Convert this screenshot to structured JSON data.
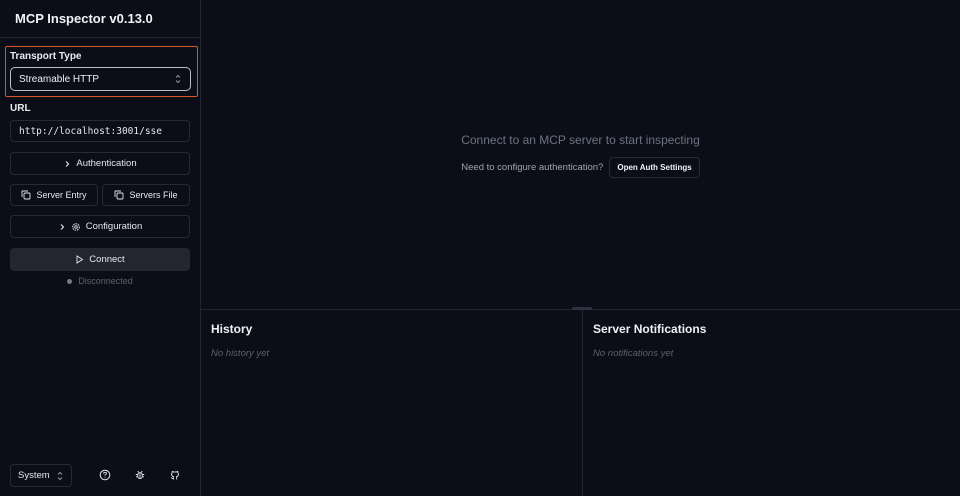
{
  "app": {
    "title": "MCP Inspector v0.13.0"
  },
  "sidebar": {
    "transport_label": "Transport Type",
    "transport_value": "Streamable HTTP",
    "url_label": "URL",
    "url_value": "http://localhost:3001/sse",
    "authentication_label": "Authentication",
    "server_entry_label": "Server Entry",
    "servers_file_label": "Servers File",
    "configuration_label": "Configuration",
    "connect_label": "Connect",
    "status_text": "Disconnected",
    "theme_value": "System",
    "footer_icons": [
      "help-icon",
      "bug-icon",
      "github-icon"
    ]
  },
  "main": {
    "empty_title": "Connect to an MCP server to start inspecting",
    "auth_prompt": "Need to configure authentication?",
    "auth_button": "Open Auth Settings"
  },
  "history": {
    "title": "History",
    "empty": "No history yet"
  },
  "notifications": {
    "title": "Server Notifications",
    "empty": "No notifications yet"
  },
  "colors": {
    "background": "#0b0e16",
    "focus_outline": "#d9582b",
    "connect_button": "#232631",
    "status_dot": "#767b8a"
  }
}
